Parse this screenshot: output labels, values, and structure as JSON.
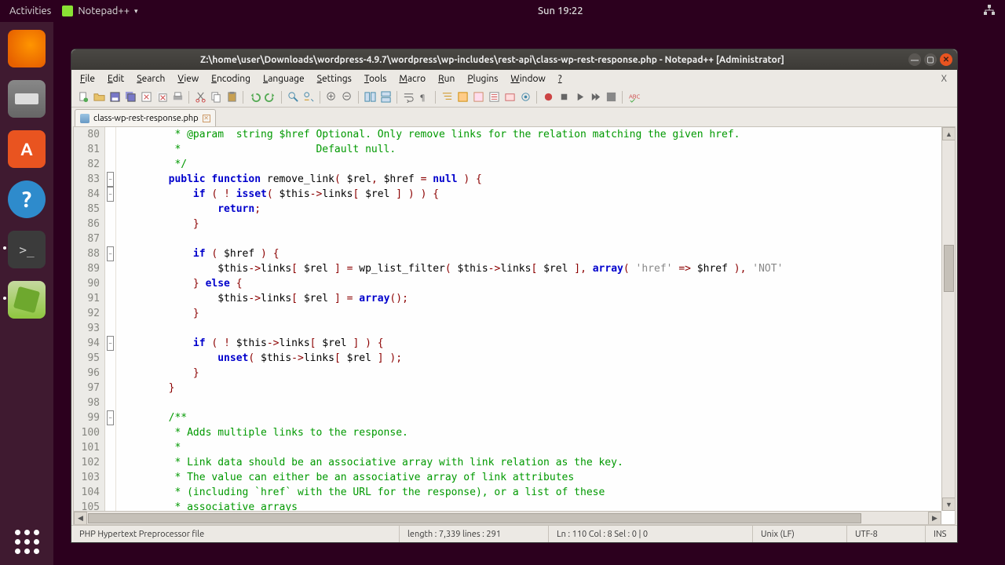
{
  "topbar": {
    "activities": "Activities",
    "app": "Notepad++",
    "clock": "Sun 19:22"
  },
  "window": {
    "title": "Z:\\home\\user\\Downloads\\wordpress-4.9.7\\wordpress\\wp-includes\\rest-api\\class-wp-rest-response.php - Notepad++ [Administrator]"
  },
  "menubar": [
    "File",
    "Edit",
    "Search",
    "View",
    "Encoding",
    "Language",
    "Settings",
    "Tools",
    "Macro",
    "Run",
    "Plugins",
    "Window",
    "?"
  ],
  "tab": {
    "name": "class-wp-rest-response.php"
  },
  "gutter_start": 80,
  "code": [
    {
      "t": "c",
      "txt": "         * @param  string $href Optional. Only remove links for the relation matching the given href."
    },
    {
      "t": "c",
      "txt": "         *                      Default null."
    },
    {
      "t": "c",
      "txt": "         */"
    },
    {
      "t": "r",
      "fold": "-",
      "seg": [
        [
          "p",
          "        "
        ],
        [
          "kw",
          "public"
        ],
        [
          "p",
          " "
        ],
        [
          "kw",
          "function"
        ],
        [
          "p",
          " remove_link"
        ],
        [
          "br",
          "("
        ],
        [
          "p",
          " $rel"
        ],
        [
          "op",
          ","
        ],
        [
          "p",
          " $href "
        ],
        [
          "op",
          "="
        ],
        [
          "p",
          " "
        ],
        [
          "kw",
          "null"
        ],
        [
          "p",
          " "
        ],
        [
          "br",
          ")"
        ],
        [
          "p",
          " "
        ],
        [
          "br",
          "{"
        ]
      ]
    },
    {
      "t": "r",
      "fold": "-",
      "seg": [
        [
          "p",
          "            "
        ],
        [
          "kw",
          "if"
        ],
        [
          "p",
          " "
        ],
        [
          "br",
          "("
        ],
        [
          "p",
          " "
        ],
        [
          "op",
          "!"
        ],
        [
          "p",
          " "
        ],
        [
          "kw",
          "isset"
        ],
        [
          "br",
          "("
        ],
        [
          "p",
          " $this"
        ],
        [
          "ar",
          "->"
        ],
        [
          "p",
          "links"
        ],
        [
          "br",
          "["
        ],
        [
          "p",
          " $rel "
        ],
        [
          "br",
          "]"
        ],
        [
          "p",
          " "
        ],
        [
          "br",
          ")"
        ],
        [
          "p",
          " "
        ],
        [
          "br",
          ")"
        ],
        [
          "p",
          " "
        ],
        [
          "br",
          "{"
        ]
      ]
    },
    {
      "t": "r",
      "seg": [
        [
          "p",
          "                "
        ],
        [
          "kw",
          "return"
        ],
        [
          "op",
          ";"
        ]
      ]
    },
    {
      "t": "r",
      "seg": [
        [
          "p",
          "            "
        ],
        [
          "br",
          "}"
        ]
      ]
    },
    {
      "t": "r",
      "seg": [
        [
          "p",
          ""
        ]
      ]
    },
    {
      "t": "r",
      "fold": "-",
      "seg": [
        [
          "p",
          "            "
        ],
        [
          "kw",
          "if"
        ],
        [
          "p",
          " "
        ],
        [
          "br",
          "("
        ],
        [
          "p",
          " $href "
        ],
        [
          "br",
          ")"
        ],
        [
          "p",
          " "
        ],
        [
          "br",
          "{"
        ]
      ]
    },
    {
      "t": "r",
      "seg": [
        [
          "p",
          "                $this"
        ],
        [
          "ar",
          "->"
        ],
        [
          "p",
          "links"
        ],
        [
          "br",
          "["
        ],
        [
          "p",
          " $rel "
        ],
        [
          "br",
          "]"
        ],
        [
          "p",
          " "
        ],
        [
          "op",
          "="
        ],
        [
          "p",
          " wp_list_filter"
        ],
        [
          "br",
          "("
        ],
        [
          "p",
          " $this"
        ],
        [
          "ar",
          "->"
        ],
        [
          "p",
          "links"
        ],
        [
          "br",
          "["
        ],
        [
          "p",
          " $rel "
        ],
        [
          "br",
          "]"
        ],
        [
          "op",
          ","
        ],
        [
          "p",
          " "
        ],
        [
          "kw",
          "array"
        ],
        [
          "br",
          "("
        ],
        [
          "p",
          " "
        ],
        [
          "st",
          "'href'"
        ],
        [
          "p",
          " "
        ],
        [
          "op",
          "=>"
        ],
        [
          "p",
          " $href "
        ],
        [
          "br",
          ")"
        ],
        [
          "op",
          ","
        ],
        [
          "p",
          " "
        ],
        [
          "st",
          "'NOT'"
        ]
      ]
    },
    {
      "t": "r",
      "seg": [
        [
          "p",
          "            "
        ],
        [
          "br",
          "}"
        ],
        [
          "p",
          " "
        ],
        [
          "kw",
          "else"
        ],
        [
          "p",
          " "
        ],
        [
          "br",
          "{"
        ]
      ]
    },
    {
      "t": "r",
      "seg": [
        [
          "p",
          "                $this"
        ],
        [
          "ar",
          "->"
        ],
        [
          "p",
          "links"
        ],
        [
          "br",
          "["
        ],
        [
          "p",
          " $rel "
        ],
        [
          "br",
          "]"
        ],
        [
          "p",
          " "
        ],
        [
          "op",
          "="
        ],
        [
          "p",
          " "
        ],
        [
          "kw",
          "array"
        ],
        [
          "br",
          "("
        ],
        [
          "br",
          ")"
        ],
        [
          "op",
          ";"
        ]
      ]
    },
    {
      "t": "r",
      "seg": [
        [
          "p",
          "            "
        ],
        [
          "br",
          "}"
        ]
      ]
    },
    {
      "t": "r",
      "seg": [
        [
          "p",
          ""
        ]
      ]
    },
    {
      "t": "r",
      "fold": "-",
      "seg": [
        [
          "p",
          "            "
        ],
        [
          "kw",
          "if"
        ],
        [
          "p",
          " "
        ],
        [
          "br",
          "("
        ],
        [
          "p",
          " "
        ],
        [
          "op",
          "!"
        ],
        [
          "p",
          " $this"
        ],
        [
          "ar",
          "->"
        ],
        [
          "p",
          "links"
        ],
        [
          "br",
          "["
        ],
        [
          "p",
          " $rel "
        ],
        [
          "br",
          "]"
        ],
        [
          "p",
          " "
        ],
        [
          "br",
          ")"
        ],
        [
          "p",
          " "
        ],
        [
          "br",
          "{"
        ]
      ]
    },
    {
      "t": "r",
      "seg": [
        [
          "p",
          "                "
        ],
        [
          "kw",
          "unset"
        ],
        [
          "br",
          "("
        ],
        [
          "p",
          " $this"
        ],
        [
          "ar",
          "->"
        ],
        [
          "p",
          "links"
        ],
        [
          "br",
          "["
        ],
        [
          "p",
          " $rel "
        ],
        [
          "br",
          "]"
        ],
        [
          "p",
          " "
        ],
        [
          "br",
          ")"
        ],
        [
          "op",
          ";"
        ]
      ]
    },
    {
      "t": "r",
      "seg": [
        [
          "p",
          "            "
        ],
        [
          "br",
          "}"
        ]
      ]
    },
    {
      "t": "r",
      "seg": [
        [
          "p",
          "        "
        ],
        [
          "br",
          "}"
        ]
      ]
    },
    {
      "t": "r",
      "seg": [
        [
          "p",
          ""
        ]
      ]
    },
    {
      "t": "c",
      "fold": "-",
      "txt": "        /**"
    },
    {
      "t": "c",
      "txt": "         * Adds multiple links to the response."
    },
    {
      "t": "c",
      "txt": "         *"
    },
    {
      "t": "c",
      "txt": "         * Link data should be an associative array with link relation as the key."
    },
    {
      "t": "c",
      "txt": "         * The value can either be an associative array of link attributes"
    },
    {
      "t": "c",
      "txt": "         * (including `href` with the URL for the response), or a list of these"
    },
    {
      "t": "c",
      "txt": "         * associative arrays"
    }
  ],
  "status": {
    "filetype": "PHP Hypertext Preprocessor file",
    "length_lbl": "length : 7,339    lines : 291",
    "pos": "Ln : 110    Col : 8    Sel : 0 | 0",
    "eol": "Unix (LF)",
    "enc": "UTF-8",
    "ins": "INS"
  }
}
